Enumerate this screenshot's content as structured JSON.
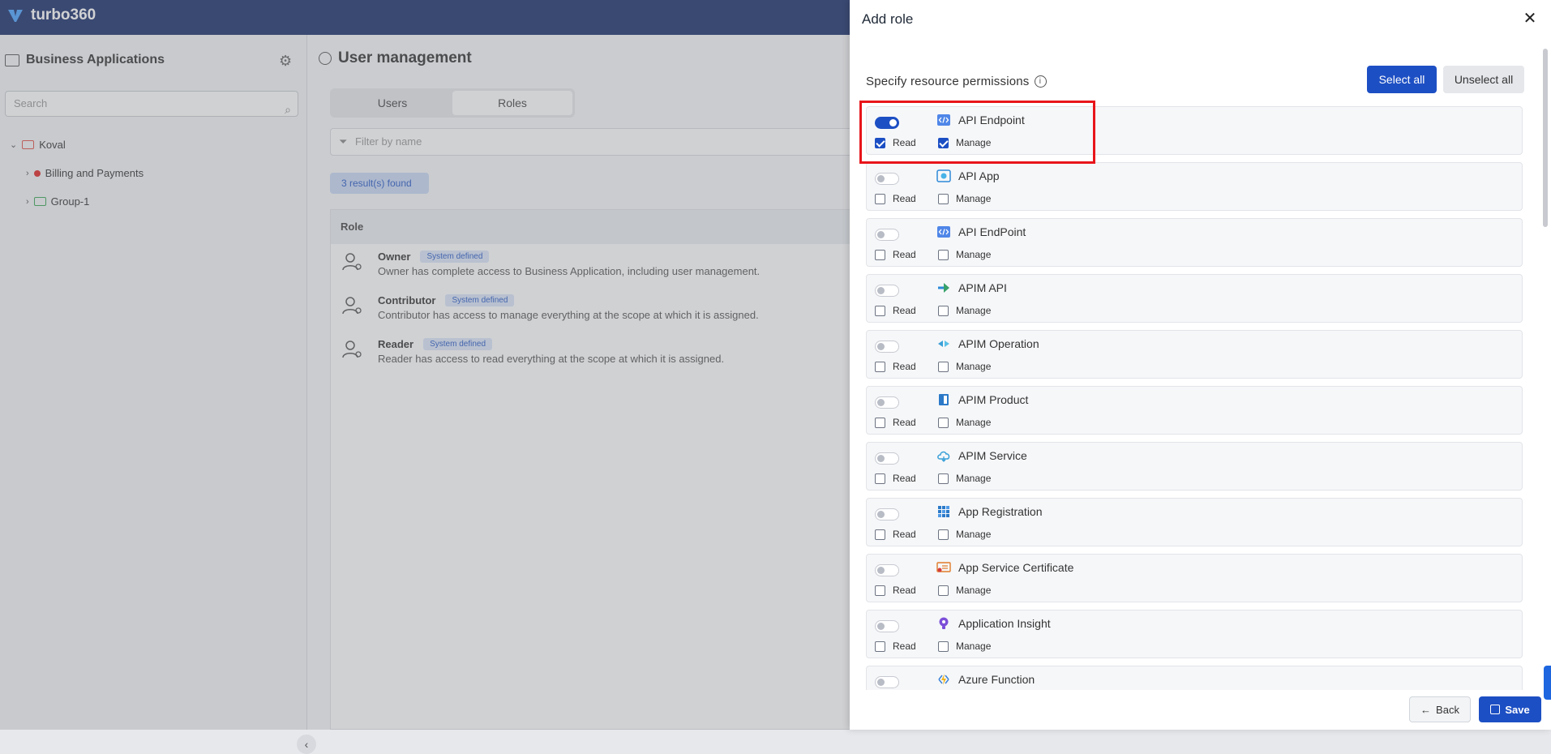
{
  "app": {
    "brand": "turbo360"
  },
  "left_panel": {
    "title": "Business Applications",
    "search_placeholder": "Search",
    "tree": [
      {
        "label": "Koval"
      },
      {
        "label": "Billing and Payments"
      },
      {
        "label": "Group-1"
      }
    ]
  },
  "main": {
    "title": "User management",
    "tabs": [
      {
        "label": "Users"
      },
      {
        "label": "Roles"
      }
    ],
    "filter_placeholder": "Filter by name",
    "results": "3 result(s) found",
    "table_header": "Role",
    "roles": [
      {
        "name": "Owner",
        "badge": "System defined",
        "desc": "Owner has complete access to Business Application, including user management."
      },
      {
        "name": "Contributor",
        "badge": "System defined",
        "desc": "Contributor has access to manage everything at the scope at which it is assigned."
      },
      {
        "name": "Reader",
        "badge": "System defined",
        "desc": "Reader has access to read everything at the scope at which it is assigned."
      }
    ]
  },
  "drawer": {
    "title": "Add role",
    "permissions_label": "Specify resource permissions",
    "select_all": "Select all",
    "unselect_all": "Unselect all",
    "read_label": "Read",
    "manage_label": "Manage",
    "back": "Back",
    "save": "Save",
    "resources": [
      {
        "name": "API Endpoint",
        "enabled": true,
        "read": true,
        "manage": true,
        "icon": "api-icon"
      },
      {
        "name": "API App",
        "enabled": false,
        "read": false,
        "manage": false,
        "icon": "api-app-icon"
      },
      {
        "name": "API EndPoint",
        "enabled": false,
        "read": false,
        "manage": false,
        "icon": "api-icon"
      },
      {
        "name": "APIM API",
        "enabled": false,
        "read": false,
        "manage": false,
        "icon": "apim-api-icon"
      },
      {
        "name": "APIM Operation",
        "enabled": false,
        "read": false,
        "manage": false,
        "icon": "apim-operation-icon"
      },
      {
        "name": "APIM Product",
        "enabled": false,
        "read": false,
        "manage": false,
        "icon": "apim-product-icon"
      },
      {
        "name": "APIM Service",
        "enabled": false,
        "read": false,
        "manage": false,
        "icon": "cloud-icon"
      },
      {
        "name": "App Registration",
        "enabled": false,
        "read": false,
        "manage": false,
        "icon": "grid-icon"
      },
      {
        "name": "App Service Certificate",
        "enabled": false,
        "read": false,
        "manage": false,
        "icon": "certificate-icon"
      },
      {
        "name": "Application Insight",
        "enabled": false,
        "read": false,
        "manage": false,
        "icon": "bulb-icon"
      },
      {
        "name": "Azure Function",
        "enabled": false,
        "read": false,
        "manage": false,
        "icon": "function-icon"
      }
    ]
  }
}
